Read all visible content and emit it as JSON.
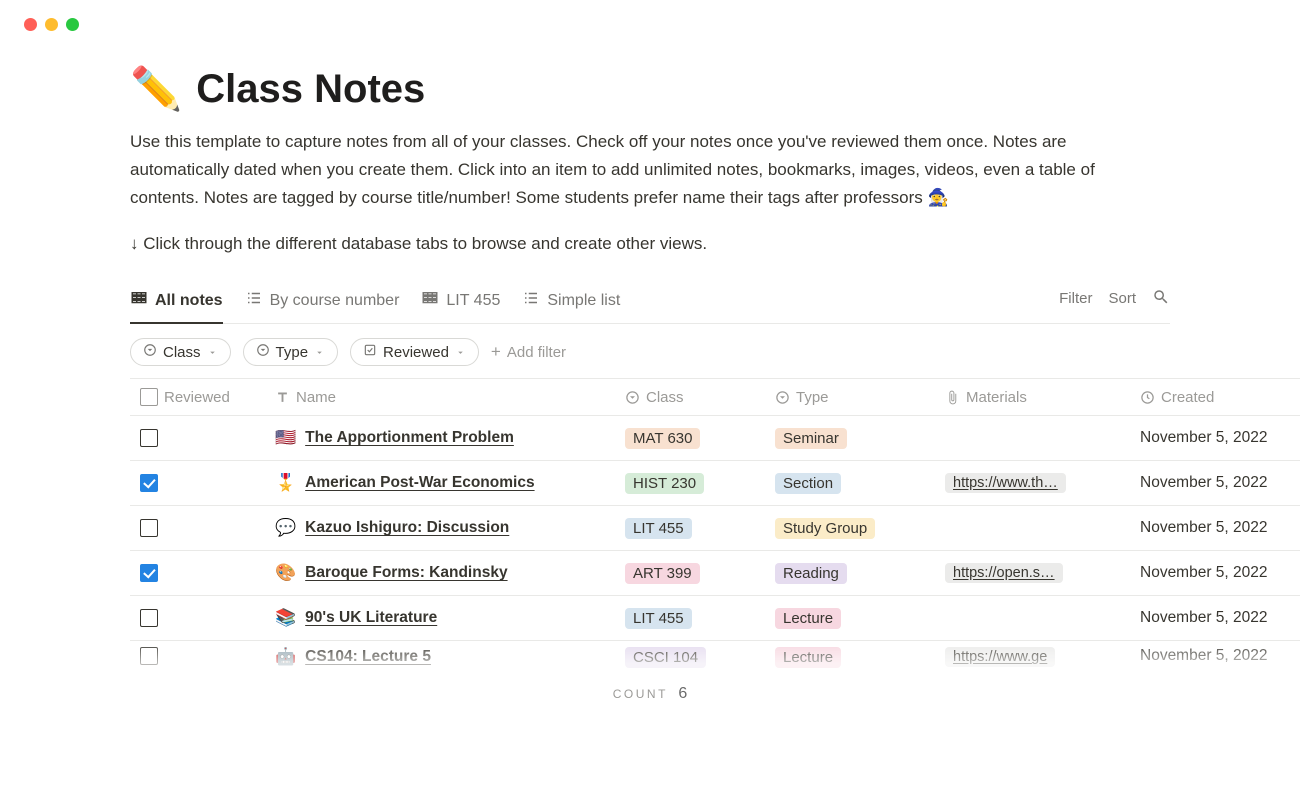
{
  "page": {
    "icon": "✏️",
    "title": "Class Notes",
    "description": "Use this template to capture notes from all of your classes. Check off your notes once you've reviewed them once. Notes are automatically dated when you create them. Click into an item to add unlimited notes, bookmarks, images, videos, even a table of contents. Notes are tagged by course title/number!  Some students prefer name their tags after professors 🧙‍♀️",
    "hint": "↓ Click through the different database tabs to browse and create other views."
  },
  "views": {
    "tabs": [
      {
        "label": "All notes",
        "icon": "table",
        "active": true
      },
      {
        "label": "By course number",
        "icon": "list",
        "active": false
      },
      {
        "label": "LIT 455",
        "icon": "table",
        "active": false
      },
      {
        "label": "Simple list",
        "icon": "list",
        "active": false
      }
    ],
    "actions": {
      "filter": "Filter",
      "sort": "Sort"
    }
  },
  "filters": {
    "pills": [
      {
        "label": "Class",
        "icon": "select"
      },
      {
        "label": "Type",
        "icon": "select"
      },
      {
        "label": "Reviewed",
        "icon": "checkbox"
      }
    ],
    "add": "Add filter"
  },
  "columns": {
    "reviewed": "Reviewed",
    "name": "Name",
    "class": "Class",
    "type": "Type",
    "materials": "Materials",
    "created": "Created"
  },
  "tag_colors": {
    "MAT 630": "#f8e1d0",
    "HIST 230": "#d6ecd8",
    "LIT 455": "#d6e4ef",
    "ART 399": "#f7d7e0",
    "CSCI 104": "#e5dcef",
    "Seminar": "#f8e1d0",
    "Section": "#d6e4ef",
    "Study Group": "#fbecc8",
    "Reading": "#e5dcef",
    "Lecture": "#f7d7e0"
  },
  "rows": [
    {
      "reviewed": false,
      "emoji": "🇺🇸",
      "name": "The Apportionment Problem",
      "class": "MAT 630",
      "type": "Seminar",
      "materials": "",
      "created": "November 5, 2022"
    },
    {
      "reviewed": true,
      "emoji": "🎖️",
      "name": "American Post-War Economics",
      "class": "HIST 230",
      "type": "Section",
      "materials": "https://www.th…",
      "created": "November 5, 2022"
    },
    {
      "reviewed": false,
      "emoji": "💬",
      "name": "Kazuo Ishiguro: Discussion",
      "class": "LIT 455",
      "type": "Study Group",
      "materials": "",
      "created": "November 5, 2022"
    },
    {
      "reviewed": true,
      "emoji": "🎨",
      "name": "Baroque Forms: Kandinsky",
      "class": "ART 399",
      "type": "Reading",
      "materials": "https://open.s…",
      "created": "November 5, 2022"
    },
    {
      "reviewed": false,
      "emoji": "📚",
      "name": "90's UK Literature",
      "class": "LIT 455",
      "type": "Lecture",
      "materials": "",
      "created": "November 5, 2022"
    },
    {
      "reviewed": false,
      "emoji": "🤖",
      "name": "CS104: Lecture 5",
      "class": "CSCI 104",
      "type": "Lecture",
      "materials": "https://www.ge",
      "created": "November 5, 2022"
    }
  ],
  "count": {
    "label": "COUNT",
    "value": "6"
  }
}
